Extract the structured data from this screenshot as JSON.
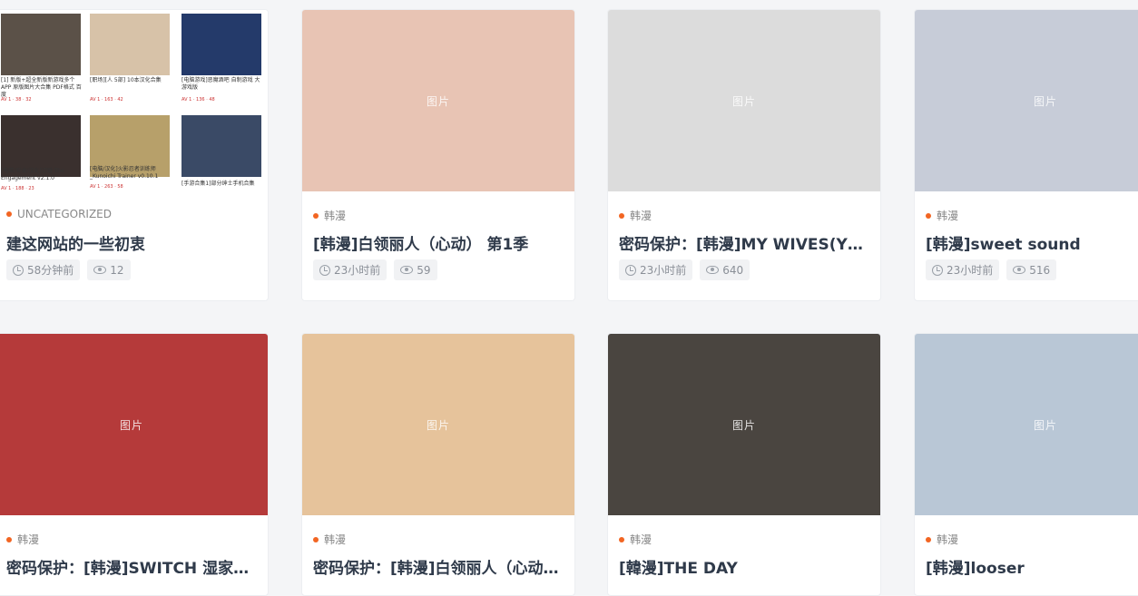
{
  "cards": [
    {
      "category": "UNCATEGORIZED",
      "title": "建这网站的一些初衷",
      "time": "58分钟前",
      "views": "12",
      "thumb_color": "#e9e3dc"
    },
    {
      "category": "韩漫",
      "title": "[韩漫]白领丽人（心动） 第1季",
      "time": "23小时前",
      "views": "59",
      "thumb_color": "#e8c4b4"
    },
    {
      "category": "韩漫",
      "title": "密码保护：[韩漫]MY WIVES(YD…",
      "time": "23小时前",
      "views": "640",
      "thumb_color": "#dcdcdc"
    },
    {
      "category": "韩漫",
      "title": "[韩漫]sweet sound",
      "time": "23小时前",
      "views": "516",
      "thumb_color": "#c7ccd8"
    },
    {
      "category": "韩漫",
      "title": "密码保护：[韩漫]SWITCH 湿家侦…",
      "time": "",
      "views": "",
      "thumb_color": "#b53a3a"
    },
    {
      "category": "韩漫",
      "title": "密码保护：[韩漫]白领丽人（心动）…",
      "time": "",
      "views": "",
      "thumb_color": "#e6c39b"
    },
    {
      "category": "韩漫",
      "title": "[韓漫]THE DAY",
      "time": "",
      "views": "",
      "thumb_color": "#4a4540"
    },
    {
      "category": "韩漫",
      "title": "[韩漫]looser",
      "time": "",
      "views": "",
      "thumb_color": "#b9c7d6"
    }
  ],
  "collage": {
    "tiles": [
      {
        "color": "#5b5148",
        "caption": "[1] 新版+超全新版新游戏多个APP 原版图片大合集 PDF格式 百度",
        "meta": "AV 1 · 38 · 32"
      },
      {
        "color": "#d7c2a8",
        "caption": "[职场][人 5部] 10本汉化合集",
        "meta": "AV 1 · 163 · 42"
      },
      {
        "color": "#243a6a",
        "caption": "[电脑游戏]恶魔酒吧 自制游戏 大游戏版",
        "meta": "AV 1 · 136 · 48"
      },
      {
        "color": "#3a302e",
        "caption": "[电脑/安卓/汉化]订婚 The Engagement v2.1.0",
        "meta": "AV 1 · 188 · 23"
      },
      {
        "color": "#b7a06a",
        "caption": "[电脑/汉化]火影忍者训练师 _Kunoichi Trainer v0.10.1",
        "meta": "AV 1 · 263 · 58"
      },
      {
        "color": "#3a4a66",
        "caption": "[手游合集1]部分绅士手机合集",
        "meta": ""
      }
    ]
  },
  "placeholder_label": "图片"
}
